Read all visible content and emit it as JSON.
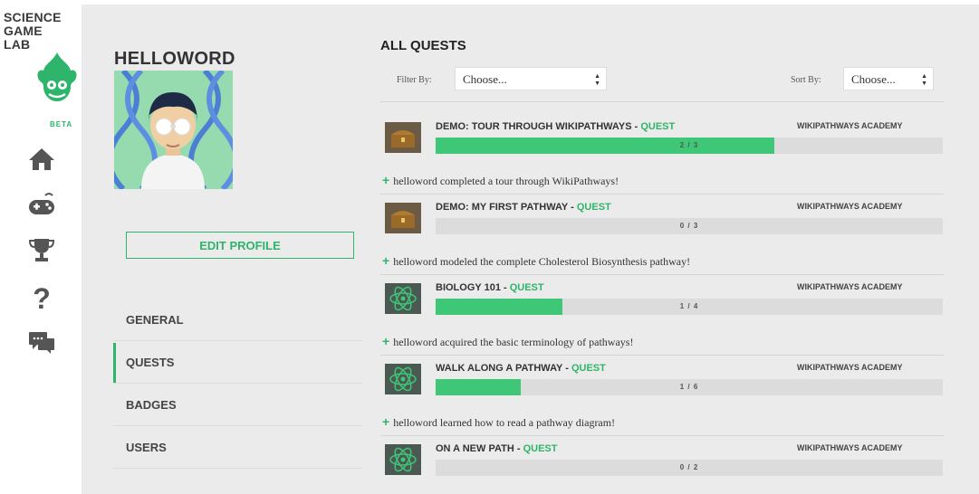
{
  "brand": {
    "line1": "SCIENCE",
    "line2": "GAME",
    "line3": "LAB",
    "beta": "BETA"
  },
  "nav_icons": [
    "home-icon",
    "gamepad-icon",
    "trophy-icon",
    "help-icon",
    "chat-icon"
  ],
  "profile": {
    "username": "HELLOWORD",
    "edit_button": "EDIT PROFILE",
    "nav": [
      "GENERAL",
      "QUESTS",
      "BADGES",
      "USERS"
    ],
    "active_nav": "QUESTS"
  },
  "quests_panel": {
    "title": "ALL QUESTS",
    "filter_label": "Filter By:",
    "filter_value": "Choose...",
    "sort_label": "Sort By:",
    "sort_value": "Choose..."
  },
  "quests": [
    {
      "name": "DEMO: TOUR THROUGH WIKIPATHWAYS",
      "type": "QUEST",
      "academy": "WIKIPATHWAYS ACADEMY",
      "progress": "2 / 3",
      "fraction": 0.667,
      "icon": "treasure-chest-icon",
      "activity": "helloword completed a tour through WikiPathways!"
    },
    {
      "name": "DEMO: MY FIRST PATHWAY",
      "type": "QUEST",
      "academy": "WIKIPATHWAYS ACADEMY",
      "progress": "0 / 3",
      "fraction": 0.0,
      "icon": "treasure-chest-icon",
      "activity": "helloword modeled the complete Cholesterol Biosynthesis pathway!"
    },
    {
      "name": "BIOLOGY 101",
      "type": "QUEST",
      "academy": "WIKIPATHWAYS ACADEMY",
      "progress": "1 / 4",
      "fraction": 0.25,
      "icon": "atom-icon",
      "activity": "helloword acquired the basic terminology of pathways!"
    },
    {
      "name": "WALK ALONG A PATHWAY",
      "type": "QUEST",
      "academy": "WIKIPATHWAYS ACADEMY",
      "progress": "1 / 6",
      "fraction": 0.167,
      "icon": "atom-icon",
      "activity": "helloword learned how to read a pathway diagram!"
    },
    {
      "name": "ON A NEW PATH",
      "type": "QUEST",
      "academy": "WIKIPATHWAYS ACADEMY",
      "progress": "0 / 2",
      "fraction": 0.0,
      "icon": "atom-icon"
    }
  ],
  "colors": {
    "accent": "#2fb56b",
    "progress_fill": "#3ec777",
    "panel_bg": "#ebebeb"
  }
}
